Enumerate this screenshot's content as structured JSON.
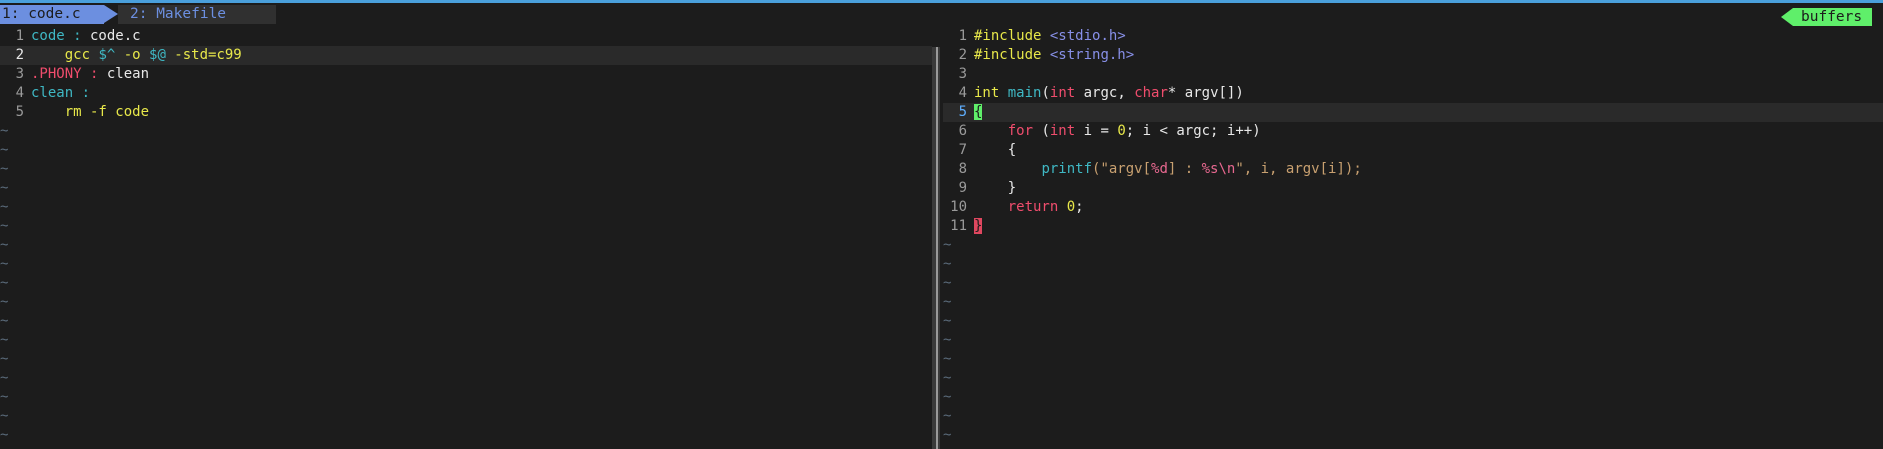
{
  "tabs": [
    {
      "label": "1: code.c"
    },
    {
      "label": "2: Makefile"
    }
  ],
  "buffers_label": "buffers",
  "colors": {
    "accent": "#6c8fe0",
    "buffers": "#5fef6a",
    "background": "#1c1c1c"
  },
  "left_pane": {
    "file": "Makefile",
    "lines": [
      {
        "num": "1",
        "text": ""
      },
      {
        "num": "2",
        "text": ""
      },
      {
        "num": "3",
        "text": ""
      },
      {
        "num": "4",
        "text": ""
      },
      {
        "num": "5",
        "text": ""
      }
    ],
    "tokens": {
      "l1a": "code :",
      "l1b": " code.c",
      "l2a": "    gcc ",
      "l2b": "$^",
      "l2c": " -o ",
      "l2d": "$@",
      "l2e": " -std=c99",
      "l3a": ".PHONY :",
      "l3b": " clean",
      "l4a": "clean :",
      "l5a": "    rm -f code"
    }
  },
  "right_pane": {
    "file": "code.c",
    "tokens": {
      "l1a": "#include",
      "l1b": " <stdio.h>",
      "l2a": "#include",
      "l2b": " <string.h>",
      "l4a": "int",
      "l4b": " ",
      "l4c": "main",
      "l4d": "(",
      "l4e": "int",
      "l4f": " argc, ",
      "l4g": "char",
      "l4h": "* argv[])",
      "l5a": "{",
      "l6a": "    ",
      "l6b": "for",
      "l6c": " (",
      "l6d": "int",
      "l6e": " i = ",
      "l6f": "0",
      "l6g": "; i < argc; i++)",
      "l7a": "    {",
      "l8a": "        ",
      "l8b": "printf",
      "l8c": "(\"argv[",
      "l8d": "%d",
      "l8e": "] : ",
      "l8f": "%s\\n",
      "l8g": "\", i, argv[i]);",
      "l9a": "    }",
      "l10a": "    ",
      "l10b": "return",
      "l10c": " ",
      "l10d": "0",
      "l10e": ";",
      "l11a": "}"
    }
  },
  "tilde": "~"
}
